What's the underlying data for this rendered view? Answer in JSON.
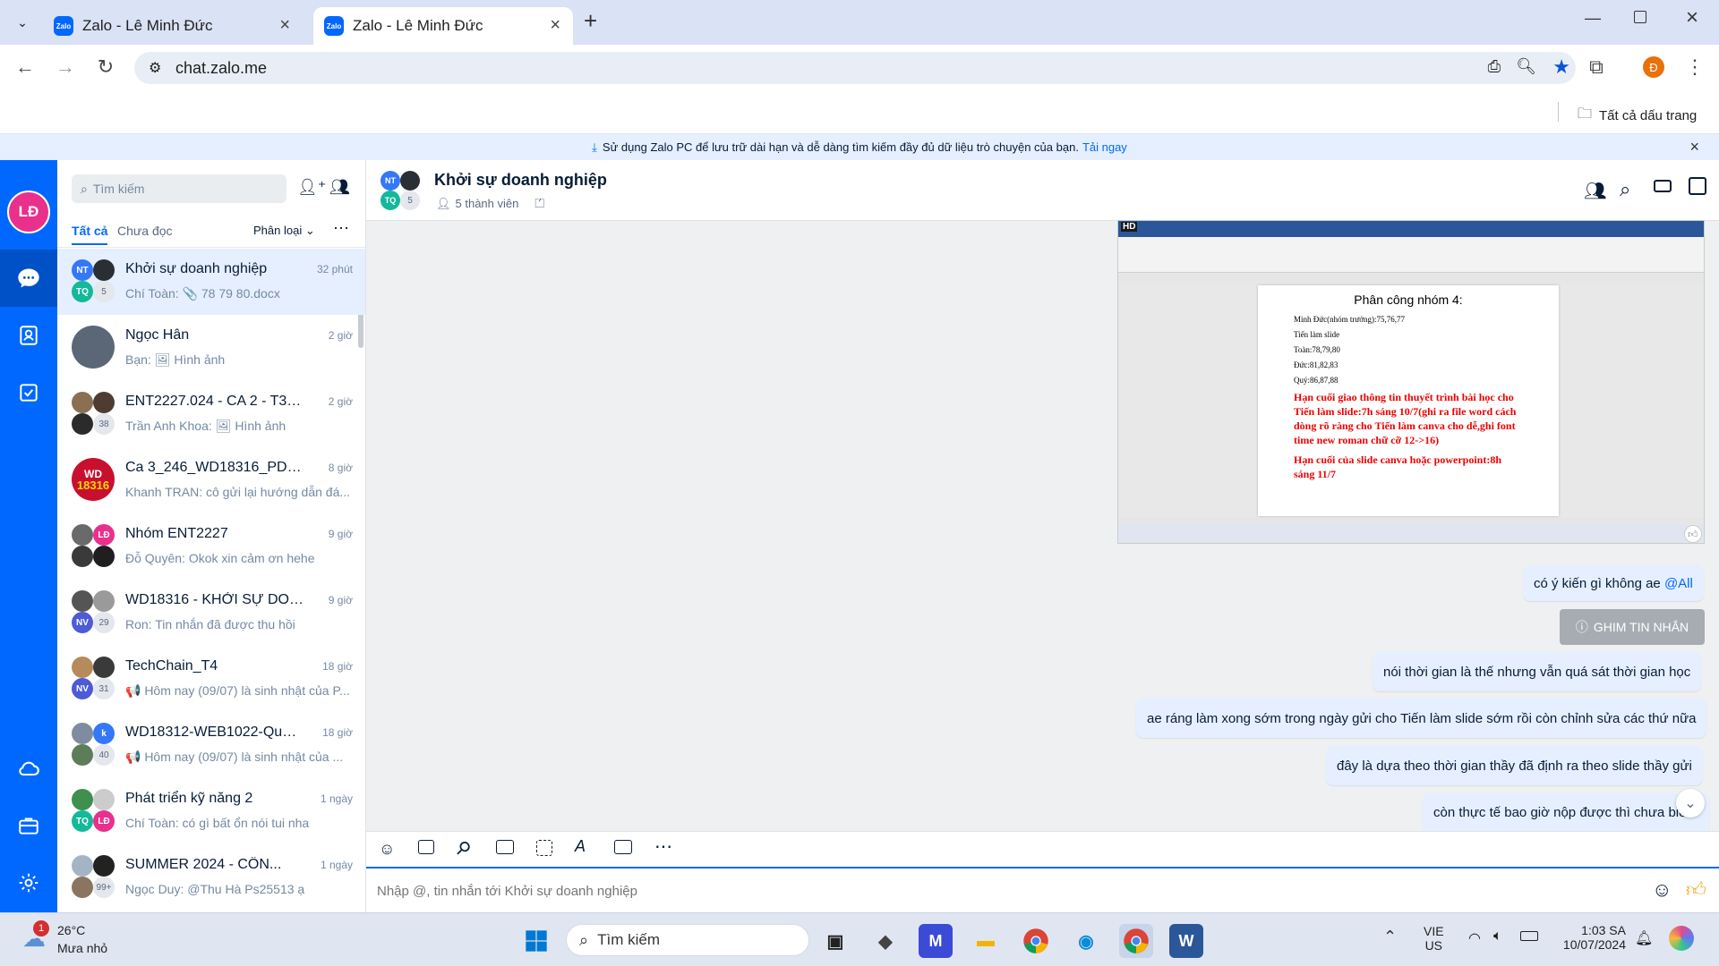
{
  "browser": {
    "tabs": [
      {
        "label": "Zalo - Lê Minh Đức"
      },
      {
        "label": "Zalo - Lê Minh Đức"
      }
    ],
    "url": "chat.zalo.me",
    "bookmarks_label": "Tất cả dấu trang",
    "profile_initial": "Đ"
  },
  "banner": {
    "text": "Sử dụng Zalo PC để lưu trữ dài hạn và dễ dàng tìm kiếm đầy đủ dữ liệu trò chuyện của bạn.",
    "link": "Tải ngay"
  },
  "navbar": {
    "avatar_initials": "LĐ"
  },
  "sidebar": {
    "search_placeholder": "Tìm kiếm",
    "filters": {
      "all": "Tất cả",
      "unread": "Chưa đọc",
      "classify": "Phân loại"
    },
    "conversations": [
      {
        "name": "Khởi sự doanh nghiệp",
        "preview": "Chí Toàn: 📎 78 79 80.docx",
        "time": "32 phút",
        "count": "5"
      },
      {
        "name": "Ngọc Hân",
        "preview": "Bạn: 🖼 Hình ảnh",
        "time": "2 giờ"
      },
      {
        "name": "ENT2227.024 - CA 2 - T3,5,7",
        "preview": "Trần Anh Khoa: 🖼 Hình ảnh",
        "time": "2 giờ",
        "count": "38"
      },
      {
        "name": "Ca 3_246_WD18316_PDP201_...",
        "preview": "Khanh TRAN: cô gửi lại hướng dẫn đá...",
        "time": "8 giờ"
      },
      {
        "name": "Nhóm ENT2227",
        "preview": "Đỗ Quyên: Okok xin cảm ơn hehe",
        "time": "9 giờ"
      },
      {
        "name": "WD18316 - KHỞI SỰ DOANH ...",
        "preview": "Ron: Tin nhắn đã được thu hồi",
        "time": "9 giờ",
        "count": "29"
      },
      {
        "name": "TechChain_T4",
        "preview": "📢 Hôm nay (09/07) là sinh nhật của P...",
        "time": "18 giờ",
        "count": "31"
      },
      {
        "name": "WD18312-WEB1022-Quản...",
        "preview": "📢 Hôm nay (09/07) là sinh nhật của ...",
        "time": "18 giờ",
        "count": "40"
      },
      {
        "name": "Phát triển kỹ năng 2",
        "preview": "Chí Toàn: có gì bất ổn nói tui nha",
        "time": "1 ngày"
      },
      {
        "name": "SUMMER 2024 - CÔN...",
        "preview": "Ngọc Duy: @Thu Hà Ps25513 ạ",
        "time": "1 ngày",
        "count": "99+"
      }
    ]
  },
  "chat": {
    "title": "Khởi sự doanh nghiệp",
    "members": "5 thành viên",
    "member_count_badge": "5",
    "messages": [
      {
        "text": "có ý kiến gì không ae",
        "mention": "@All"
      },
      {
        "text": "nói thời gian là thế nhưng vẫn quá sát thời gian học"
      },
      {
        "text": "ae ráng làm xong sớm trong ngày gửi cho Tiến làm slide sớm rồi còn chỉnh sửa các thứ nữa"
      },
      {
        "text": "đây là dựa theo thời gian thầy đã định ra theo slide thầy gửi"
      },
      {
        "text": "còn thực tế bao giờ nộp được thì chưa biết"
      }
    ],
    "pin_label": "GHIM TIN NHẮN",
    "image_doc": {
      "hd": "HD",
      "heading": "Phân công nhóm 4:",
      "lines": [
        "Minh Đức(nhóm trưởng):75,76,77",
        "Tiến làm slide",
        "Toàn:78,79,80",
        "Đức:81,82,83",
        "Quý:86,87,88"
      ],
      "red1": "Hạn cuối giao thông tin thuyết trình bài học cho Tiến làm slide:7h sáng 10/7(ghi ra file word cách dòng rõ ràng cho Tiến làm canva cho dễ,ghi font time new roman chữ cỡ 12->16)",
      "red2": "Hạn cuối của slide canva hoặc powerpoint:8h sáng 11/7"
    },
    "composer_placeholder": "Nhập @, tin nhắn tới Khởi sự doanh nghiệp"
  },
  "taskbar": {
    "weather_temp": "26°C",
    "weather_desc": "Mưa nhỏ",
    "weather_badge": "1",
    "search_placeholder": "Tìm kiếm",
    "lang1": "VIE",
    "lang2": "US",
    "time": "1:03 SA",
    "date": "10/07/2024"
  }
}
